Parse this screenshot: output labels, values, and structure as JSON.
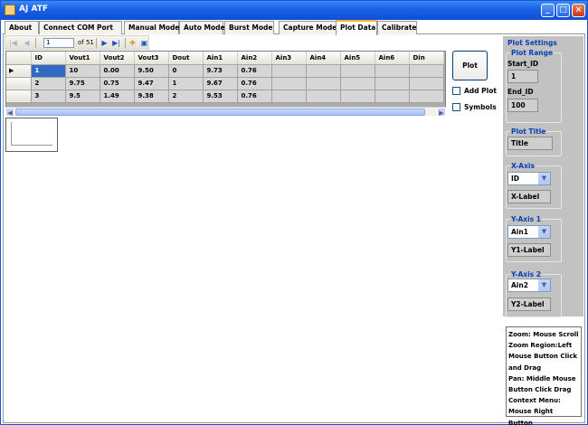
{
  "window": {
    "title": "AJ ATF"
  },
  "tabs": [
    {
      "label": "About"
    },
    {
      "label": "Connect  COM Port"
    },
    {
      "label": "Manual Mode"
    },
    {
      "label": "Auto Mode"
    },
    {
      "label": "Burst Mode"
    },
    {
      "label": "Capture Mode"
    },
    {
      "label": "Plot Data"
    },
    {
      "label": "Calibrate"
    }
  ],
  "navigator": {
    "position": "1",
    "of_label": "of 51"
  },
  "grid": {
    "columns": [
      "ID",
      "Vout1",
      "Vout2",
      "Vout3",
      "Dout",
      "Ain1",
      "Ain2",
      "Ain3",
      "Ain4",
      "Ain5",
      "Ain6",
      "Din"
    ],
    "rows": [
      [
        "1",
        "10",
        "0.00",
        "9.50",
        "0",
        "9.73",
        "0.76",
        "",
        "",
        "",
        "",
        ""
      ],
      [
        "2",
        "9.75",
        "0.75",
        "9.47",
        "1",
        "9.67",
        "0.76",
        "",
        "",
        "",
        "",
        ""
      ],
      [
        "3",
        "9.5",
        "1.49",
        "9.38",
        "2",
        "9.53",
        "0.76",
        "",
        "",
        "",
        "",
        ""
      ]
    ]
  },
  "controls": {
    "plot_button": "Plot",
    "add_plot": "Add Plot",
    "symbols": "Symbols"
  },
  "settings": {
    "title": "Plot Settings",
    "plot_range": {
      "title": "Plot Range",
      "start_label": "Start_ID",
      "start_value": "1",
      "end_label": "End_ID",
      "end_value": "100"
    },
    "plot_title": {
      "title": "Plot Title",
      "value": "Title"
    },
    "x_axis": {
      "title": "X-Axis",
      "selected": "ID",
      "label": "X-Label"
    },
    "y_axis1": {
      "title": "Y-Axis 1",
      "selected": "Ain1",
      "label": "Y1-Label"
    },
    "y_axis2": {
      "title": "Y-Axis 2",
      "selected": "Ain2",
      "label": "Y2-Label"
    }
  },
  "help": {
    "lines": [
      "Zoom: Mouse Scroll",
      "Zoom Region:Left",
      "Mouse Button Click",
      "and  Drag",
      "Pan: Middle Mouse",
      "Button Click  Drag",
      "Context Menu:",
      "Mouse Right Button"
    ]
  }
}
